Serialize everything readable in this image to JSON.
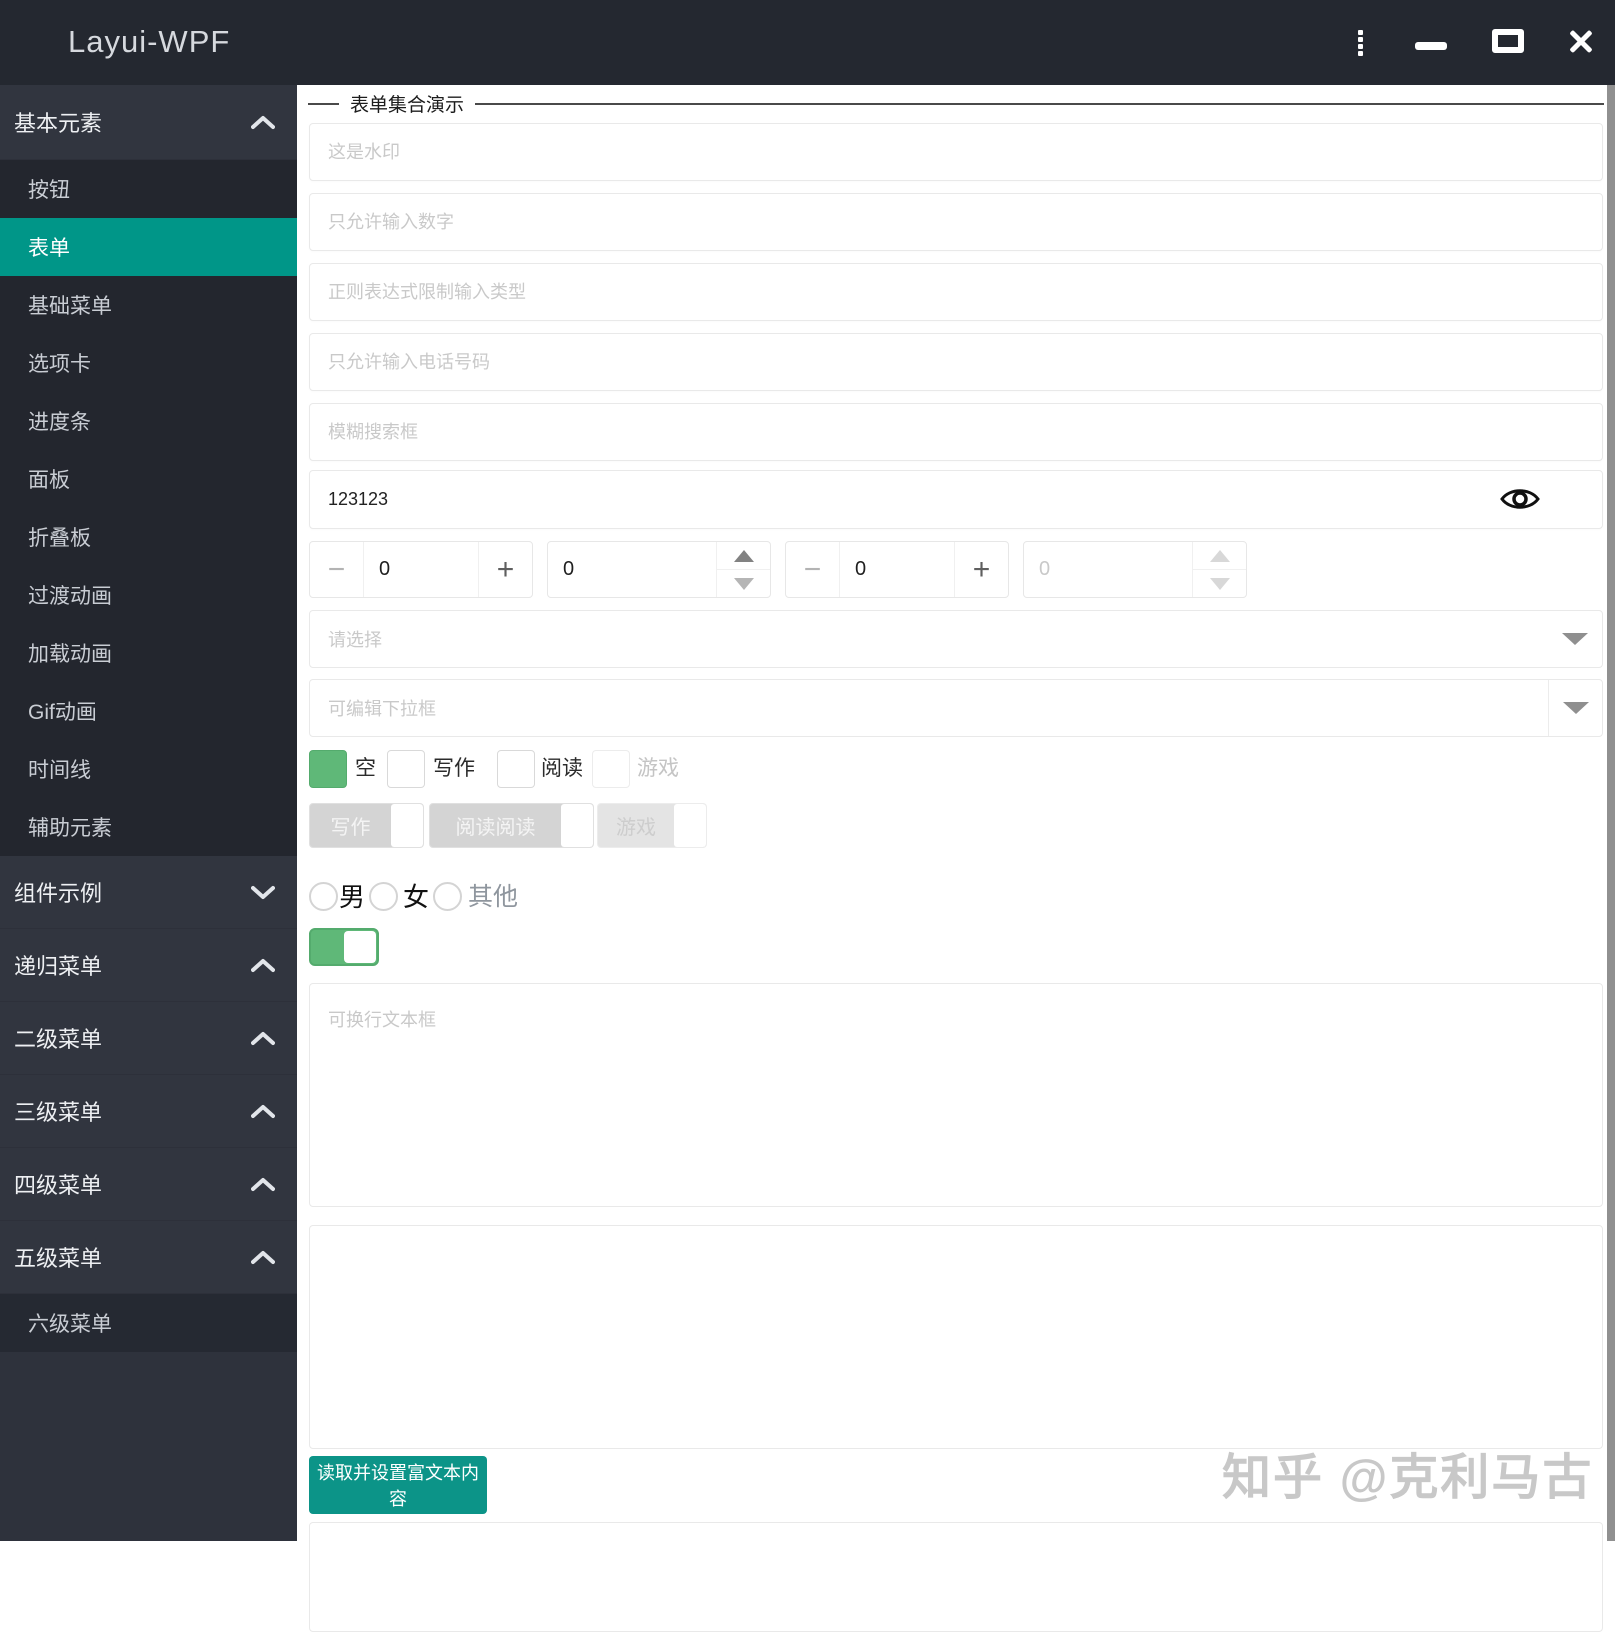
{
  "window": {
    "title": "Layui-WPF"
  },
  "colors": {
    "accent_teal": "#009688",
    "green": "#5FB878",
    "sidebar_dark": "#23262e",
    "sidebar_light": "#2e323c"
  },
  "icons": {
    "titlebar": [
      "kebab-menu-icon",
      "minimize-icon",
      "maximize-icon",
      "close-icon"
    ],
    "password": "eye-icon",
    "dropdown": "chevron-down-triangle"
  },
  "sidebar": {
    "rows": [
      {
        "type": "group",
        "label": "基本元素",
        "chevron": "up"
      },
      {
        "type": "item",
        "label": "按钮",
        "selected": false
      },
      {
        "type": "item",
        "label": "表单",
        "selected": true
      },
      {
        "type": "item",
        "label": "基础菜单",
        "selected": false
      },
      {
        "type": "item",
        "label": "选项卡",
        "selected": false
      },
      {
        "type": "item",
        "label": "进度条",
        "selected": false
      },
      {
        "type": "item",
        "label": "面板",
        "selected": false
      },
      {
        "type": "item",
        "label": "折叠板",
        "selected": false
      },
      {
        "type": "item",
        "label": "过渡动画",
        "selected": false
      },
      {
        "type": "item",
        "label": "加载动画",
        "selected": false
      },
      {
        "type": "item",
        "label": "Gif动画",
        "selected": false
      },
      {
        "type": "item",
        "label": "时间线",
        "selected": false
      },
      {
        "type": "item",
        "label": "辅助元素",
        "selected": false
      },
      {
        "type": "group",
        "label": "组件示例",
        "chevron": "down"
      },
      {
        "type": "group",
        "label": "递归菜单",
        "chevron": "up"
      },
      {
        "type": "group",
        "label": "二级菜单",
        "chevron": "up"
      },
      {
        "type": "group",
        "label": "三级菜单",
        "chevron": "up"
      },
      {
        "type": "group",
        "label": "四级菜单",
        "chevron": "up"
      },
      {
        "type": "group",
        "label": "五级菜单",
        "chevron": "up"
      },
      {
        "type": "item",
        "label": "六级菜单",
        "selected": false
      }
    ]
  },
  "form": {
    "group_title": "表单集合演示",
    "inputs": [
      "这是水印",
      "只允许输入数字",
      "正则表达式限制输入类型",
      "只允许输入电话号码",
      "模糊搜索框"
    ],
    "password": {
      "value": "123123"
    },
    "steppers": [
      {
        "value": "0",
        "style": "plus-minus",
        "disabled": false
      },
      {
        "value": "0",
        "style": "spin-arrows",
        "disabled": false
      },
      {
        "value": "0",
        "style": "plus-minus",
        "disabled": false
      },
      {
        "value": "0",
        "style": "spin-arrows",
        "disabled": true
      }
    ],
    "selects": [
      {
        "placeholder": "请选择",
        "editable": false
      },
      {
        "placeholder": "可编辑下拉框",
        "editable": true
      }
    ],
    "checkboxes": [
      {
        "label": "空",
        "checked": true,
        "disabled": false
      },
      {
        "label": "写作",
        "checked": false,
        "disabled": false
      },
      {
        "label": "阅读",
        "checked": false,
        "disabled": false
      },
      {
        "label": "游戏",
        "checked": false,
        "disabled": true
      }
    ],
    "switch_buttons": [
      {
        "label": "写作",
        "disabled": false
      },
      {
        "label": "阅读阅读",
        "disabled": false
      },
      {
        "label": "游戏",
        "disabled": true
      }
    ],
    "radios": [
      {
        "label": "男",
        "checked": false,
        "disabled": false
      },
      {
        "label": "女",
        "checked": false,
        "disabled": false
      },
      {
        "label": "其他",
        "checked": false,
        "disabled": true
      }
    ],
    "toggle": {
      "on": true
    },
    "textarea_placeholder": "可换行文本框",
    "submit_label": "读取并设置富文本内容"
  },
  "watermark": "知乎 @克利马古"
}
